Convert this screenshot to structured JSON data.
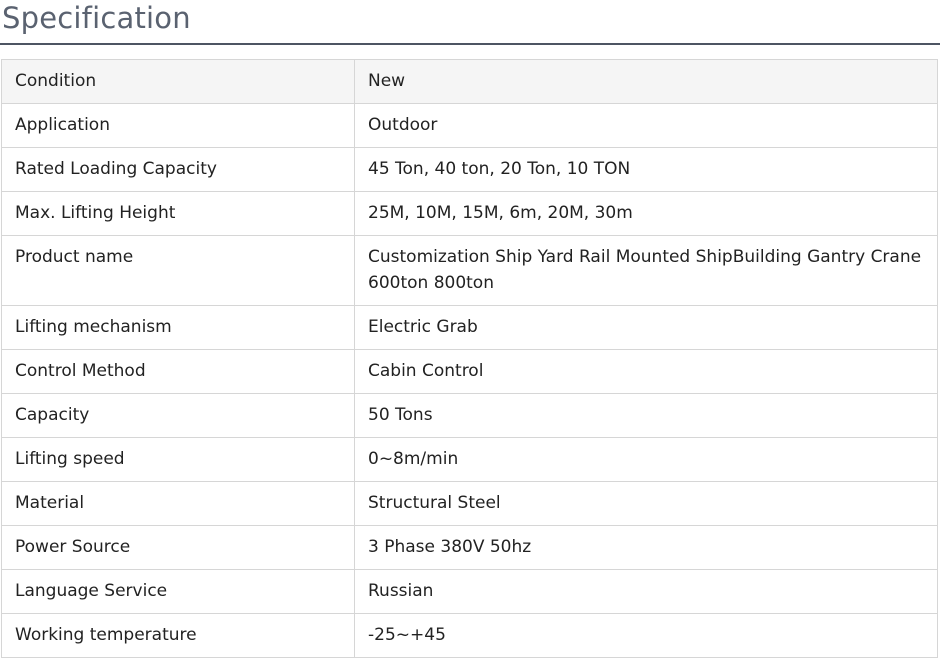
{
  "page": {
    "title": "Specification"
  },
  "spec_table": {
    "rows": [
      {
        "label": "Condition",
        "value": "New"
      },
      {
        "label": "Application",
        "value": "Outdoor"
      },
      {
        "label": "Rated Loading Capacity",
        "value": "45 Ton, 40 ton, 20 Ton, 10 TON"
      },
      {
        "label": "Max. Lifting Height",
        "value": "25M, 10M, 15M, 6m, 20M, 30m"
      },
      {
        "label": "Product name",
        "value": "Customization Ship Yard Rail Mounted ShipBuilding Gantry Crane 600ton 800ton"
      },
      {
        "label": "Lifting mechanism",
        "value": "Electric Grab"
      },
      {
        "label": "Control Method",
        "value": "Cabin Control"
      },
      {
        "label": "Capacity",
        "value": "50 Tons"
      },
      {
        "label": "Lifting speed",
        "value": "0~8m/min"
      },
      {
        "label": "Material",
        "value": "Structural Steel"
      },
      {
        "label": "Power Source",
        "value": "3 Phase 380V 50hz"
      },
      {
        "label": "Language Service",
        "value": "Russian"
      },
      {
        "label": "Working temperature",
        "value": "-25~+45"
      }
    ]
  }
}
